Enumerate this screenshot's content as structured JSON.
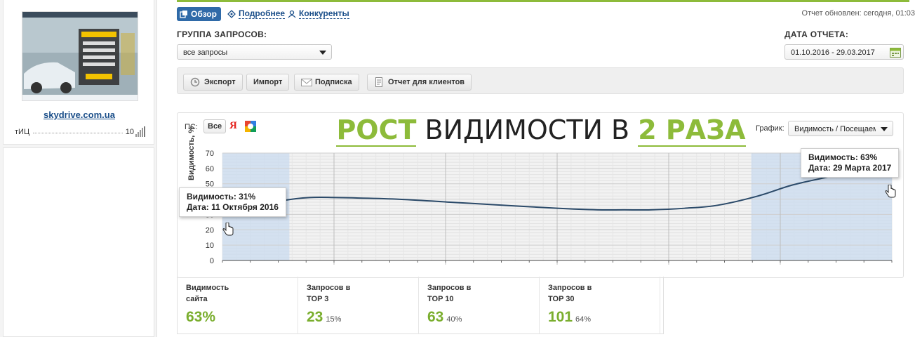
{
  "sidebar": {
    "site_name": "skydrive.com.ua",
    "tic_label": "тИЦ",
    "tic_value": "10"
  },
  "header": {
    "tabs": [
      {
        "label": "Обзор",
        "icon": "overview-icon",
        "active": true
      },
      {
        "label": "Подробнее",
        "icon": "details-icon",
        "active": false
      },
      {
        "label": "Конкуренты",
        "icon": "competitors-icon",
        "active": false
      }
    ],
    "updated": "Отчет обновлен: сегодня, 01:03"
  },
  "filters": {
    "group_label": "ГРУППА ЗАПРОСОВ:",
    "group_value": "все запросы",
    "date_label": "ДАТА ОТЧЕТА:",
    "date_value": "01.10.2016 - 29.03.2017"
  },
  "toolbar": {
    "buttons": [
      {
        "label": "Экспорт",
        "icon": "export-icon"
      },
      {
        "label": "Импорт",
        "icon": ""
      },
      {
        "label": "Подписка",
        "icon": "mail-icon"
      },
      {
        "label": "Отчет для клиентов",
        "icon": "document-icon"
      }
    ]
  },
  "chart_panel": {
    "ps_label": "ПС:",
    "ps_all": "Все",
    "ps_yandex": "Я",
    "headline_part1": "РОСТ",
    "headline_part2": "ВИДИМОСТИ В",
    "headline_part3": "2 РАЗА",
    "graph_label": "График:",
    "graph_value": "Видимость / Посещаемо",
    "ylabel": "Видимость, %",
    "tooltip_left": {
      "line1": "Видимость: 31%",
      "line2": "Дата: 11 Октября 2016"
    },
    "tooltip_right": {
      "line1": "Видимость: 63%",
      "line2": "Дата: 29 Марта 2017"
    }
  },
  "chart_data": {
    "type": "area",
    "ylim": [
      0,
      70
    ],
    "yticks": [
      0,
      10,
      20,
      30,
      40,
      50,
      60,
      70
    ],
    "xlim": [
      0,
      1
    ],
    "series": [
      {
        "x": [
          0,
          0.05,
          0.09,
          0.13,
          0.17,
          0.26,
          0.34,
          0.42,
          0.5,
          0.56,
          0.6,
          0.64,
          0.69,
          0.74,
          0.8,
          0.85,
          0.9,
          0.95,
          1.0
        ],
        "values": [
          31,
          35,
          39,
          41,
          41,
          40,
          38,
          36,
          34,
          33,
          33,
          33,
          34,
          36,
          42,
          49,
          54,
          59,
          63
        ]
      }
    ],
    "highlighted_ranges": [
      [
        0,
        0.1
      ],
      [
        0.79,
        1.0
      ]
    ],
    "grid": true
  },
  "stats": [
    {
      "title1": "Видимость",
      "title2": "сайта",
      "value": "63%",
      "pct": ""
    },
    {
      "title1": "Запросов в",
      "title2": "TOP 3",
      "value": "23",
      "pct": "15%"
    },
    {
      "title1": "Запросов в",
      "title2": "TOP 10",
      "value": "63",
      "pct": "40%"
    },
    {
      "title1": "Запросов в",
      "title2": "TOP 30",
      "value": "101",
      "pct": "64%"
    }
  ],
  "colors": {
    "accent_green": "#8dbb3a",
    "line": "#2b4a69",
    "highlight": "#c9dbef",
    "active_tab": "#2f6aa8"
  }
}
